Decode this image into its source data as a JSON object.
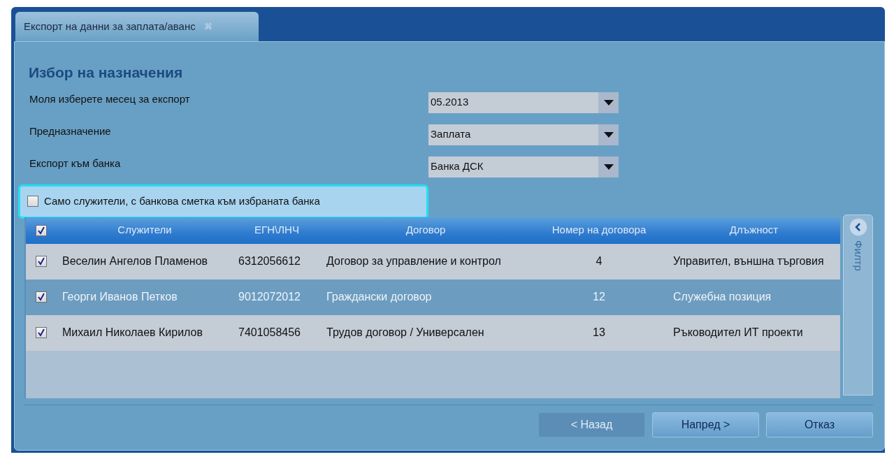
{
  "tab": {
    "label": "Експорт на данни за заплата/аванс",
    "close": "⌘"
  },
  "title": "Избор на назначения",
  "fields": [
    {
      "label": "Моля изберете месец за експорт",
      "value": "05.2013"
    },
    {
      "label": "Предназначение",
      "value": "Заплата"
    },
    {
      "label": "Експорт към банка",
      "value": "Банка ДСК"
    }
  ],
  "filter_option": {
    "label": "Само служители, с банкова сметка към избраната банка",
    "checked": false
  },
  "table": {
    "all_checked": true,
    "columns": [
      "Служители",
      "ЕГН\\ЛНЧ",
      "Договор",
      "Номер на договора",
      "Длъжност"
    ],
    "rows": [
      {
        "checked": true,
        "selected": false,
        "cells": [
          "Веселин Ангелов Пламенов",
          "6312056612",
          "Договор за управление и контрол",
          "4",
          "Управител, външна търговия"
        ]
      },
      {
        "checked": true,
        "selected": true,
        "cells": [
          "Георги Иванов Петков",
          "9012072012",
          "Граждански договор",
          "12",
          "Служебна позиция"
        ]
      },
      {
        "checked": true,
        "selected": false,
        "cells": [
          "Михаил Николаев Кирилов",
          "7401058456",
          "Трудов договор / Универсален",
          "13",
          "Ръководител ИТ проекти"
        ]
      }
    ]
  },
  "filter_panel": {
    "label": "Филтр"
  },
  "buttons": [
    {
      "label": "< Назад",
      "disabled": true
    },
    {
      "label": "Напред >",
      "disabled": false
    },
    {
      "label": "Отказ",
      "disabled": false
    }
  ]
}
